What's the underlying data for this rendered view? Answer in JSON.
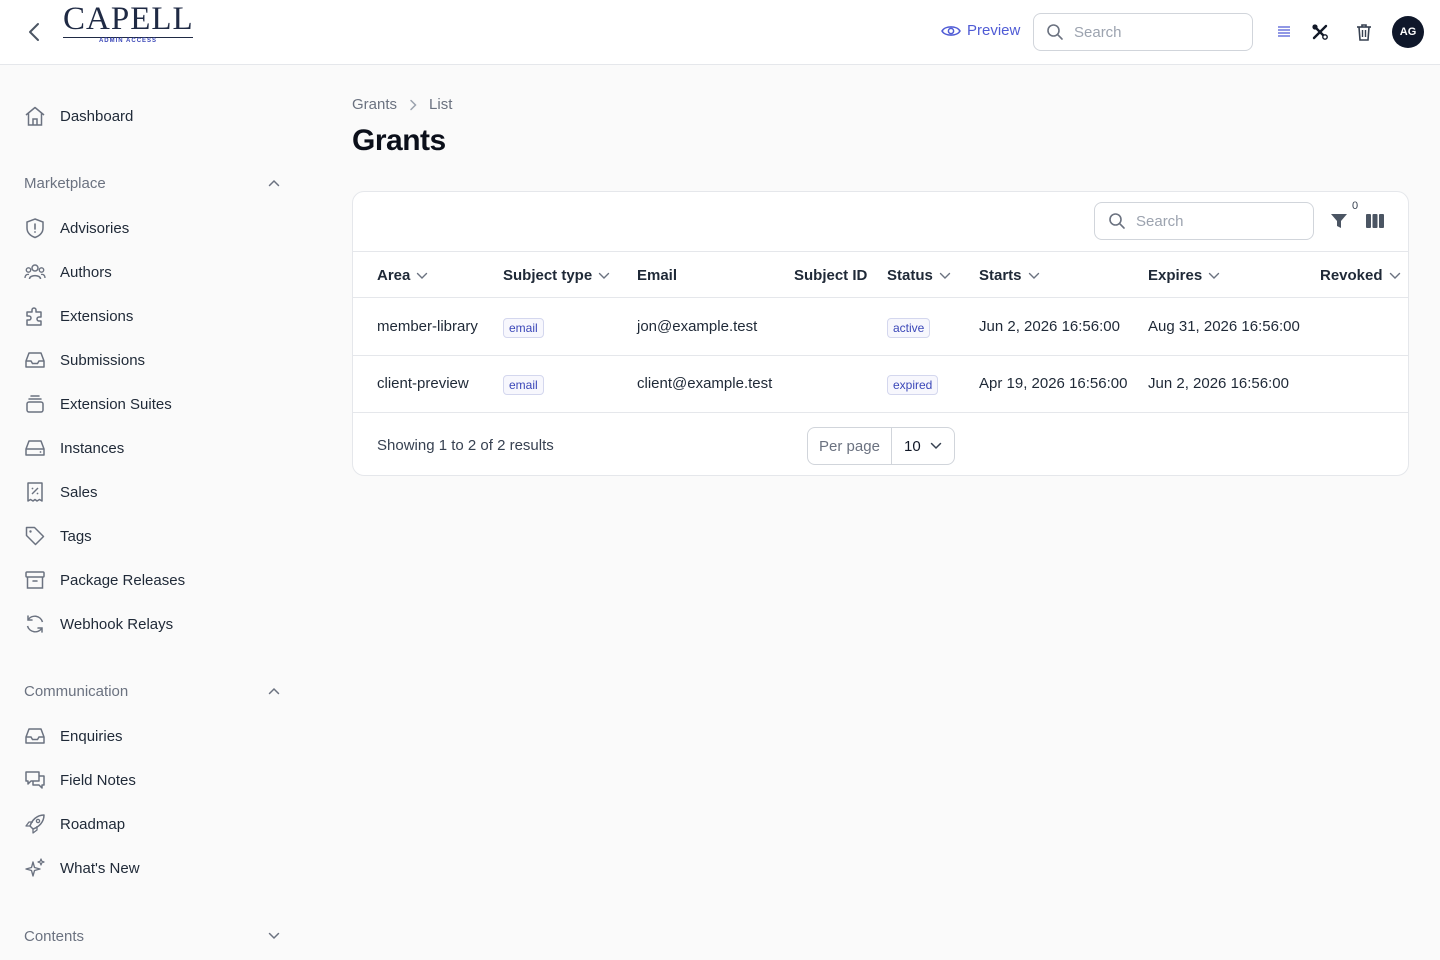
{
  "header": {
    "logo_text": "CAPELL",
    "logo_subtext": "ADMIN ACCESS",
    "preview_label": "Preview",
    "search_placeholder": "Search",
    "avatar_initials": "AG"
  },
  "sidebar": {
    "dashboard": "Dashboard",
    "groups": [
      {
        "label": "Marketplace",
        "expanded": true,
        "items": [
          "Advisories",
          "Authors",
          "Extensions",
          "Submissions",
          "Extension Suites",
          "Instances",
          "Sales",
          "Tags",
          "Package Releases",
          "Webhook Relays"
        ]
      },
      {
        "label": "Communication",
        "expanded": true,
        "items": [
          "Enquiries",
          "Field Notes",
          "Roadmap",
          "What's New"
        ]
      },
      {
        "label": "Contents",
        "expanded": false,
        "items": []
      }
    ]
  },
  "breadcrumb": {
    "parent": "Grants",
    "current": "List"
  },
  "page_title": "Grants",
  "table": {
    "search_placeholder": "Search",
    "filter_count": "0",
    "columns": [
      "Area",
      "Subject type",
      "Email",
      "Subject ID",
      "Status",
      "Starts",
      "Expires",
      "Revoked"
    ],
    "rows": [
      {
        "area": "member-library",
        "subject_type": "email",
        "email": "jon@example.test",
        "subject_id": "",
        "status": "active",
        "starts": "Jun 2, 2026 16:56:00",
        "expires": "Aug 31, 2026 16:56:00",
        "revoked": ""
      },
      {
        "area": "client-preview",
        "subject_type": "email",
        "email": "client@example.test",
        "subject_id": "",
        "status": "expired",
        "starts": "Apr 19, 2026 16:56:00",
        "expires": "Jun 2, 2026 16:56:00",
        "revoked": ""
      }
    ],
    "footer_text": "Showing 1 to 2 of 2 results",
    "per_page_label": "Per page",
    "per_page_value": "10"
  },
  "colors": {
    "accent": "#4f5bd5",
    "avatar_bg": "#0f172a",
    "badge_text": "#3b47b8"
  }
}
